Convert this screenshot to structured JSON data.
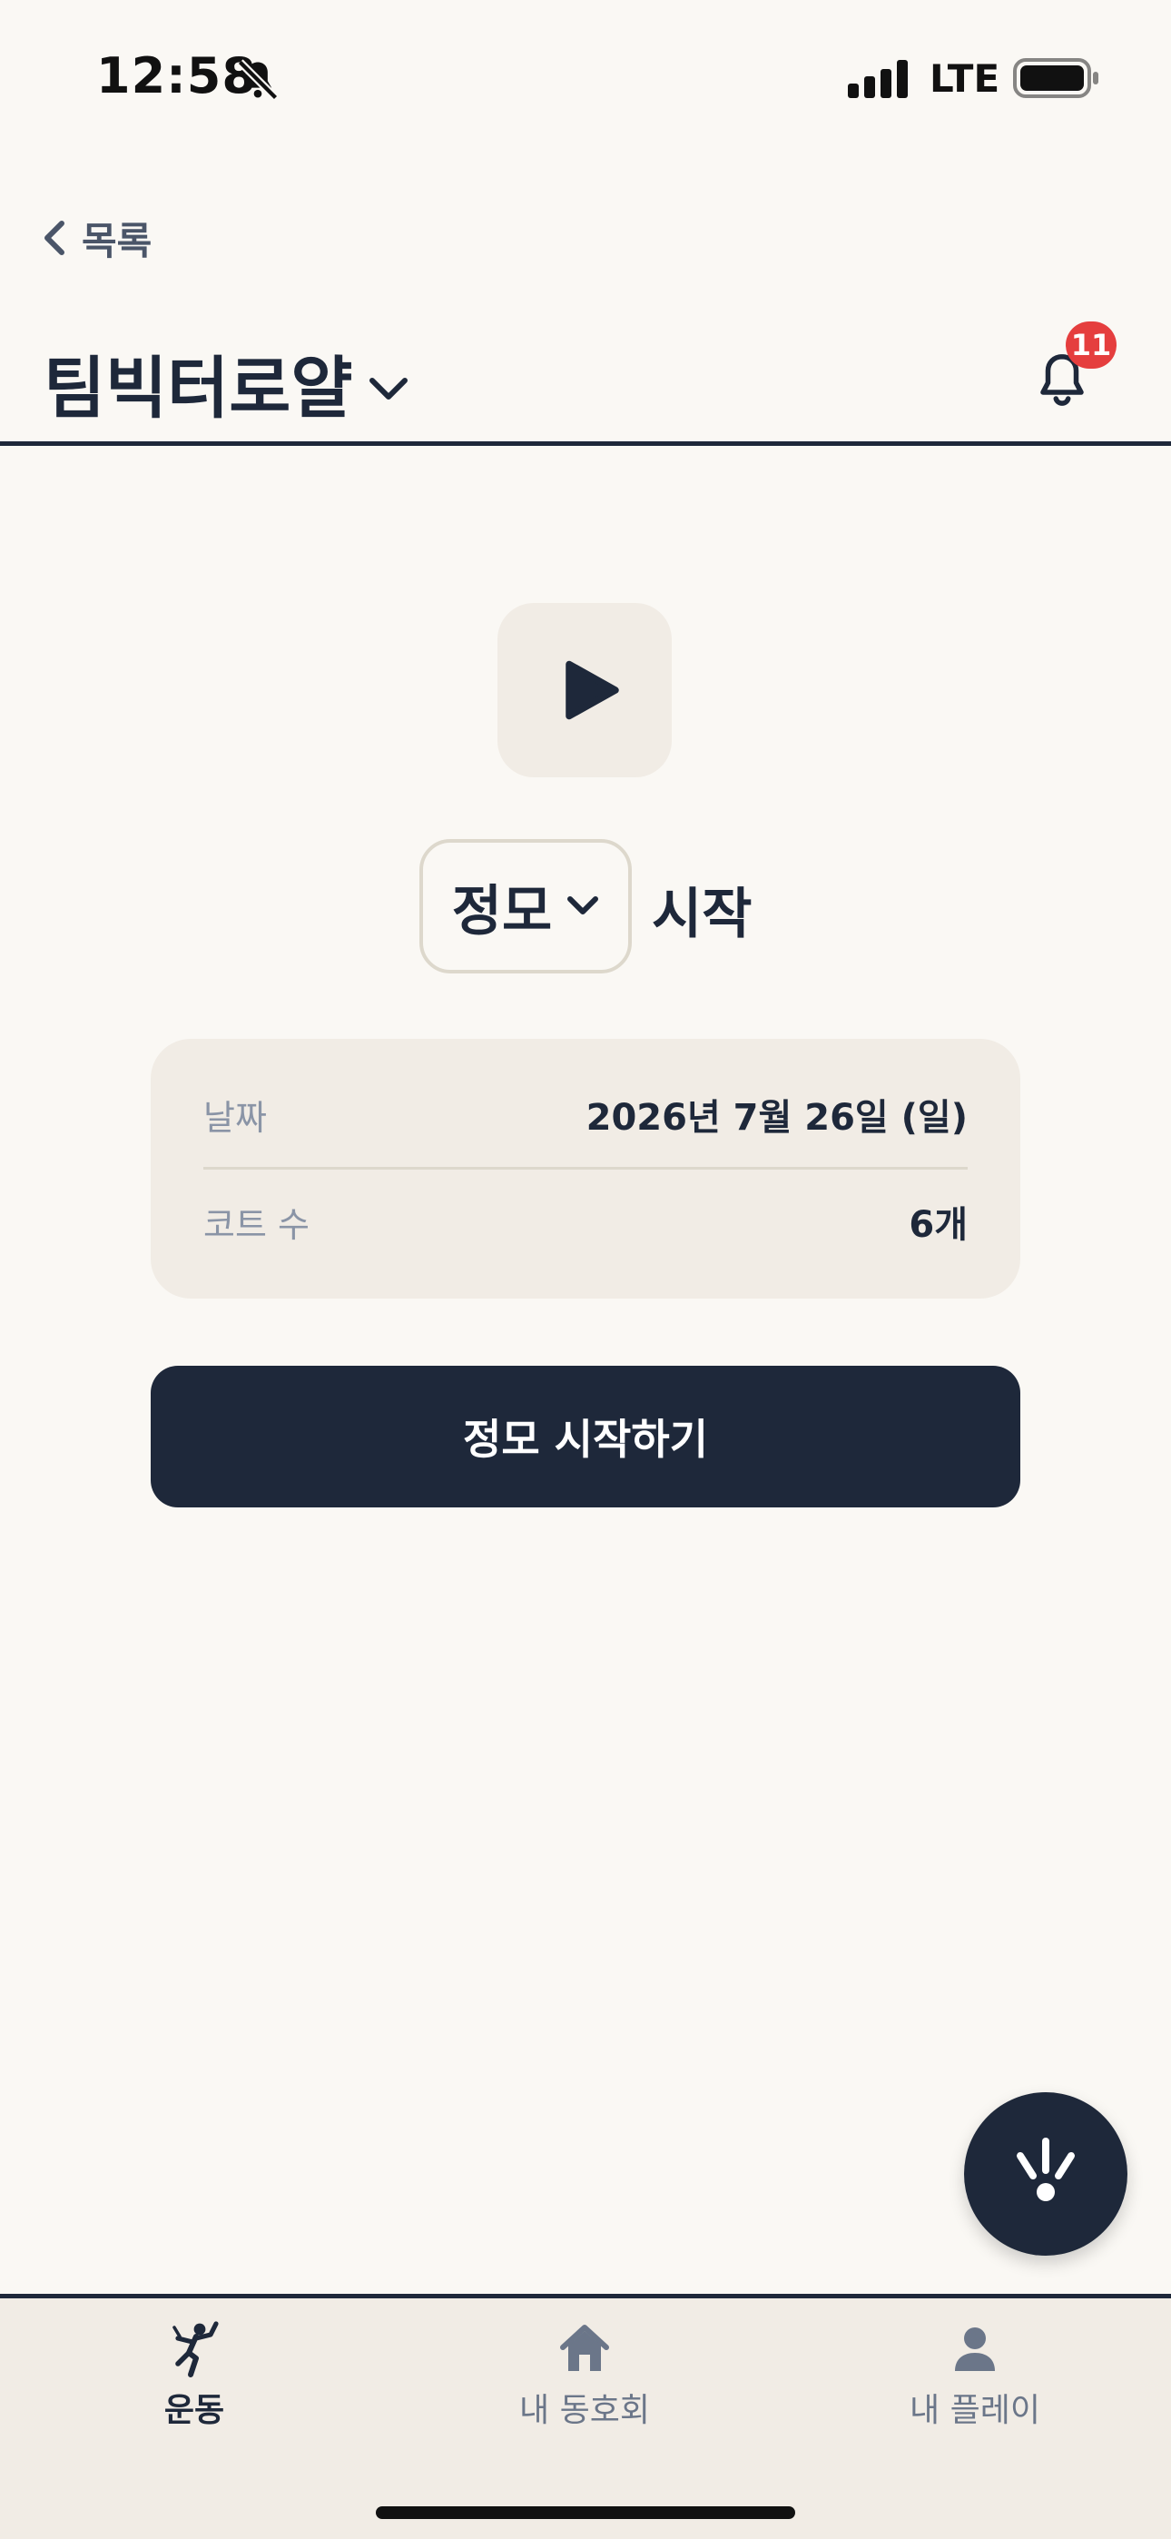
{
  "status_bar": {
    "time": "12:58",
    "network": "LTE",
    "icons": [
      "bell-slash-icon",
      "signal-bars-icon",
      "battery-icon"
    ]
  },
  "nav": {
    "back_label": "목록",
    "back_icon": "chevron-left-icon"
  },
  "header": {
    "club_name": "팀빅터로얄",
    "club_dropdown_icon": "chevron-down-icon",
    "notification_icon": "bell-icon",
    "notification_count": "11"
  },
  "session": {
    "play_icon": "play-icon",
    "mode_selected": "정모",
    "mode_dropdown_icon": "chevron-down-icon",
    "mode_suffix": "시작"
  },
  "info": {
    "date_label": "날짜",
    "date_value": "2026년 7월 26일 (일)",
    "courts_label": "코트 수",
    "courts_value": "6개"
  },
  "actions": {
    "start_label": "정모 시작하기",
    "fab_icon": "spark-alert-icon"
  },
  "tabs": [
    {
      "label": "운동",
      "icon": "badminton-player-icon",
      "active": true
    },
    {
      "label": "내 동호회",
      "icon": "house-icon",
      "active": false
    },
    {
      "label": "내 플레이",
      "icon": "person-icon",
      "active": false
    }
  ],
  "colors": {
    "primary": "#1E283A",
    "background": "#FAF8F4",
    "card": "#F1ECE5",
    "badge": "#E53E3E",
    "muted_text": "#8A94A6"
  }
}
